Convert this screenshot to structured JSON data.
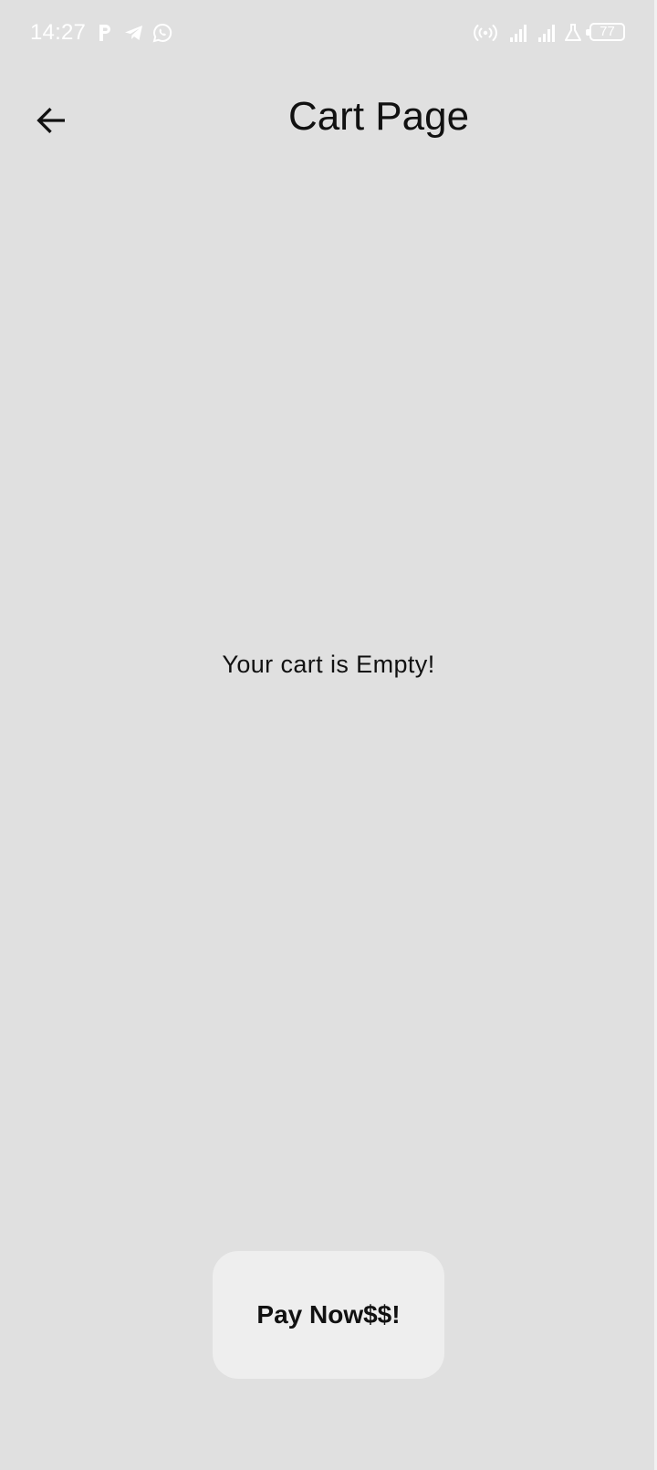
{
  "status_bar": {
    "time": "14:27",
    "battery": "77",
    "left_icons": [
      "parking-icon",
      "telegram-icon",
      "whatsapp-icon"
    ],
    "right_icons": [
      "hotspot-icon",
      "signal-1-icon",
      "signal-2-icon",
      "flask-icon",
      "battery-icon"
    ]
  },
  "app_bar": {
    "title": "Cart Page",
    "back_icon": "arrow-back-icon"
  },
  "cart": {
    "empty_message": "Your cart is Empty!"
  },
  "actions": {
    "pay_label": "Pay Now$$!"
  },
  "colors": {
    "background": "#e0e0e0",
    "button_bg": "#eeeeee",
    "text": "#111111",
    "status_text": "#ffffff"
  }
}
